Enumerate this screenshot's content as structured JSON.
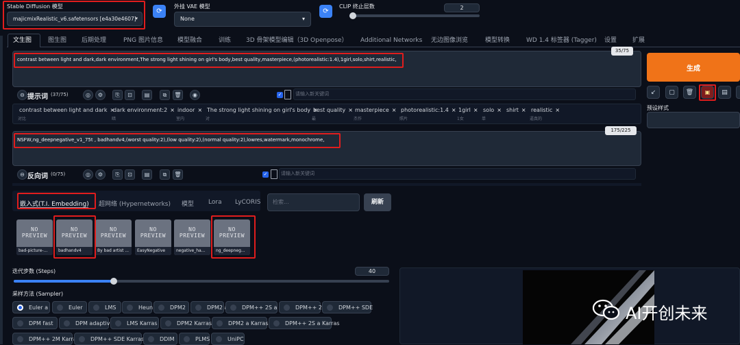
{
  "model": {
    "label": "Stable Diffusion 模型",
    "value": "majicmixRealistic_v6.safetensors [e4a30e4607]"
  },
  "vae": {
    "label": "外挂 VAE 模型",
    "value": "None"
  },
  "clip": {
    "label": "CLIP 终止层数",
    "value": "2"
  },
  "tabs": [
    "文生图",
    "图生图",
    "后期处理",
    "PNG 图片信息",
    "模型融合",
    "训练",
    "3D 骨架模型编辑（3D Openpose）",
    "Additional Networks",
    "无边图像浏览",
    "模型转换",
    "WD 1.4 标签器 (Tagger)",
    "设置",
    "扩展"
  ],
  "prompt": {
    "text": "contrast between light and dark,dark environment,The strong light shining on girl's body,best quality,masterpiece,(photorealistic:1.4),1girl,solo,shirt,realistic,",
    "counter": "35/75",
    "label": "提示词",
    "count": "(37/75)",
    "keyword_placeholder": "请输入新关键词",
    "tags": [
      {
        "text": "contrast between light and dark",
        "sub": "对比"
      },
      {
        "text": "dark environment:2",
        "sub": "暗"
      },
      {
        "text": "indoor",
        "sub": "室内"
      },
      {
        "text": "The strong light shining on girl's body",
        "sub": "对"
      },
      {
        "text": "best quality",
        "sub": "最"
      },
      {
        "text": "masterpiece",
        "sub": "杰作"
      },
      {
        "text": "photorealistic:1.4",
        "sub": "照片"
      },
      {
        "text": "1girl",
        "sub": "1女"
      },
      {
        "text": "solo",
        "sub": "单"
      },
      {
        "text": "shirt",
        "sub": ""
      },
      {
        "text": "realistic",
        "sub": "逼真的"
      }
    ]
  },
  "negative": {
    "text": "NSFW,ng_deepnegative_v1_75t , badhandv4,(worst quality:2),(low quality:2),(normal quality:2),lowres,watermark,monochrome,",
    "counter": "175/225",
    "label": "反向词",
    "count": "(0/75)",
    "keyword_placeholder": "请输入新关键词"
  },
  "network_tabs": [
    "嵌入式(T.I. Embedding)",
    "超网络 (Hypernetworks)",
    "模型",
    "Lora",
    "LyCORIS"
  ],
  "search_placeholder": "检索...",
  "refresh_label": "刷新",
  "placeholder_art": "NO\nPREVIEW",
  "embeddings": [
    "bad-picture-...",
    "badhandv4",
    "By bad artist ...",
    "EasyNegative",
    "negative_ha...",
    "ng_deepneg..."
  ],
  "steps": {
    "label": "迭代步数 (Steps)",
    "value": "40",
    "fraction": 0.27
  },
  "sampler": {
    "label": "采样方法 (Sampler)",
    "selected": "Euler a",
    "options": [
      "Euler a",
      "Euler",
      "LMS",
      "Heun",
      "DPM2",
      "DPM2 a",
      "DPM++ 2S a",
      "DPM++ 2M",
      "DPM++ SDE",
      "DPM fast",
      "DPM adaptive",
      "LMS Karras",
      "DPM2 Karras",
      "DPM2 a Karras",
      "DPM++ 2S a Karras",
      "DPM++ 2M Karras",
      "DPM++ SDE Karras",
      "DDIM",
      "PLMS",
      "UniPC"
    ]
  },
  "generate_label": "生成",
  "preset_label": "预设样式",
  "watermark": "AI开创未来",
  "colors": {
    "accent": "#f07318",
    "highlight": "#e11d1d",
    "bg": "#0b0f19"
  }
}
